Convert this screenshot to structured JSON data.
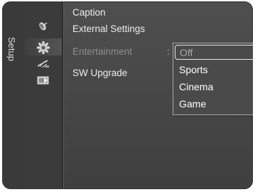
{
  "sidebar": {
    "tab_label": "Setup",
    "icons": [
      "satellite-dish-icon",
      "gear-icon",
      "antenna-icon",
      "input-icon"
    ],
    "active_index": 1
  },
  "menu": {
    "items": [
      {
        "label": "Caption",
        "dimmed": false
      },
      {
        "label": "External Settings",
        "dimmed": false
      },
      {
        "label": "Entertainment",
        "dimmed": true,
        "value_separator": ":"
      },
      {
        "label": "SW Upgrade",
        "dimmed": false
      }
    ]
  },
  "dropdown": {
    "options": [
      {
        "label": "Off",
        "selected": true
      },
      {
        "label": "Sports",
        "selected": false
      },
      {
        "label": "Cinema",
        "selected": false
      },
      {
        "label": "Game",
        "selected": false
      }
    ]
  },
  "colors": {
    "panel": "#4a4a4a",
    "text": "#ededed",
    "dimmed_text": "#8d8d8d",
    "dropdown_border": "#aaaaaa"
  }
}
